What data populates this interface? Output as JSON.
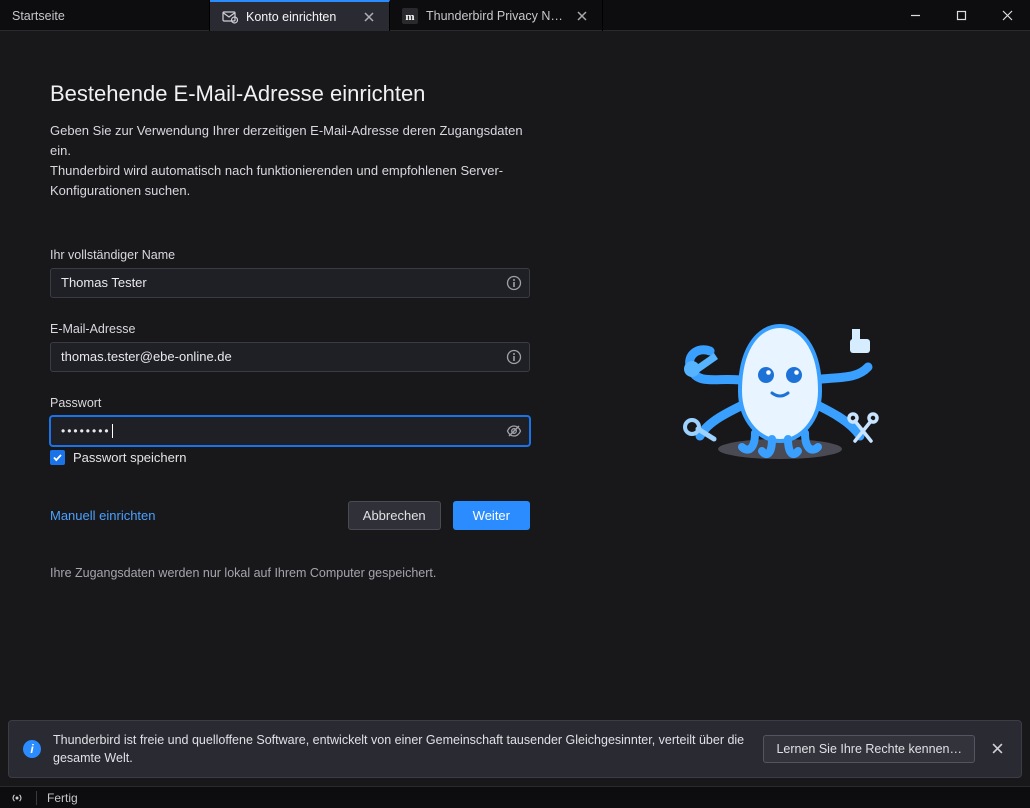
{
  "tabs": {
    "start": "Startseite",
    "active": "Konto einrichten",
    "second": "Thunderbird Privacy Notice"
  },
  "header": {
    "title": "Bestehende E-Mail-Adresse einrichten",
    "desc1": "Geben Sie zur Verwendung Ihrer derzeitigen E-Mail-Adresse deren Zugangsdaten ein.",
    "desc2": "Thunderbird wird automatisch nach funktionierenden und empfohlenen Server-Konfigurationen suchen."
  },
  "form": {
    "name_label": "Ihr vollständiger Name",
    "name_value": "Thomas Tester",
    "email_label": "E-Mail-Adresse",
    "email_value": "thomas.tester@ebe-online.de",
    "password_label": "Passwort",
    "password_value": "••••••••",
    "remember_label": "Passwort speichern",
    "manual_link": "Manuell einrichten",
    "cancel": "Abbrechen",
    "continue": "Weiter",
    "note": "Ihre Zugangsdaten werden nur lokal auf Ihrem Computer gespeichert."
  },
  "notif": {
    "text": "Thunderbird ist freie und quelloffene Software, entwickelt von einer Gemeinschaft tausender Gleichgesinnter, verteilt über die gesamte Welt.",
    "button": "Lernen Sie Ihre Rechte kennen…"
  },
  "status": {
    "text": "Fertig"
  }
}
